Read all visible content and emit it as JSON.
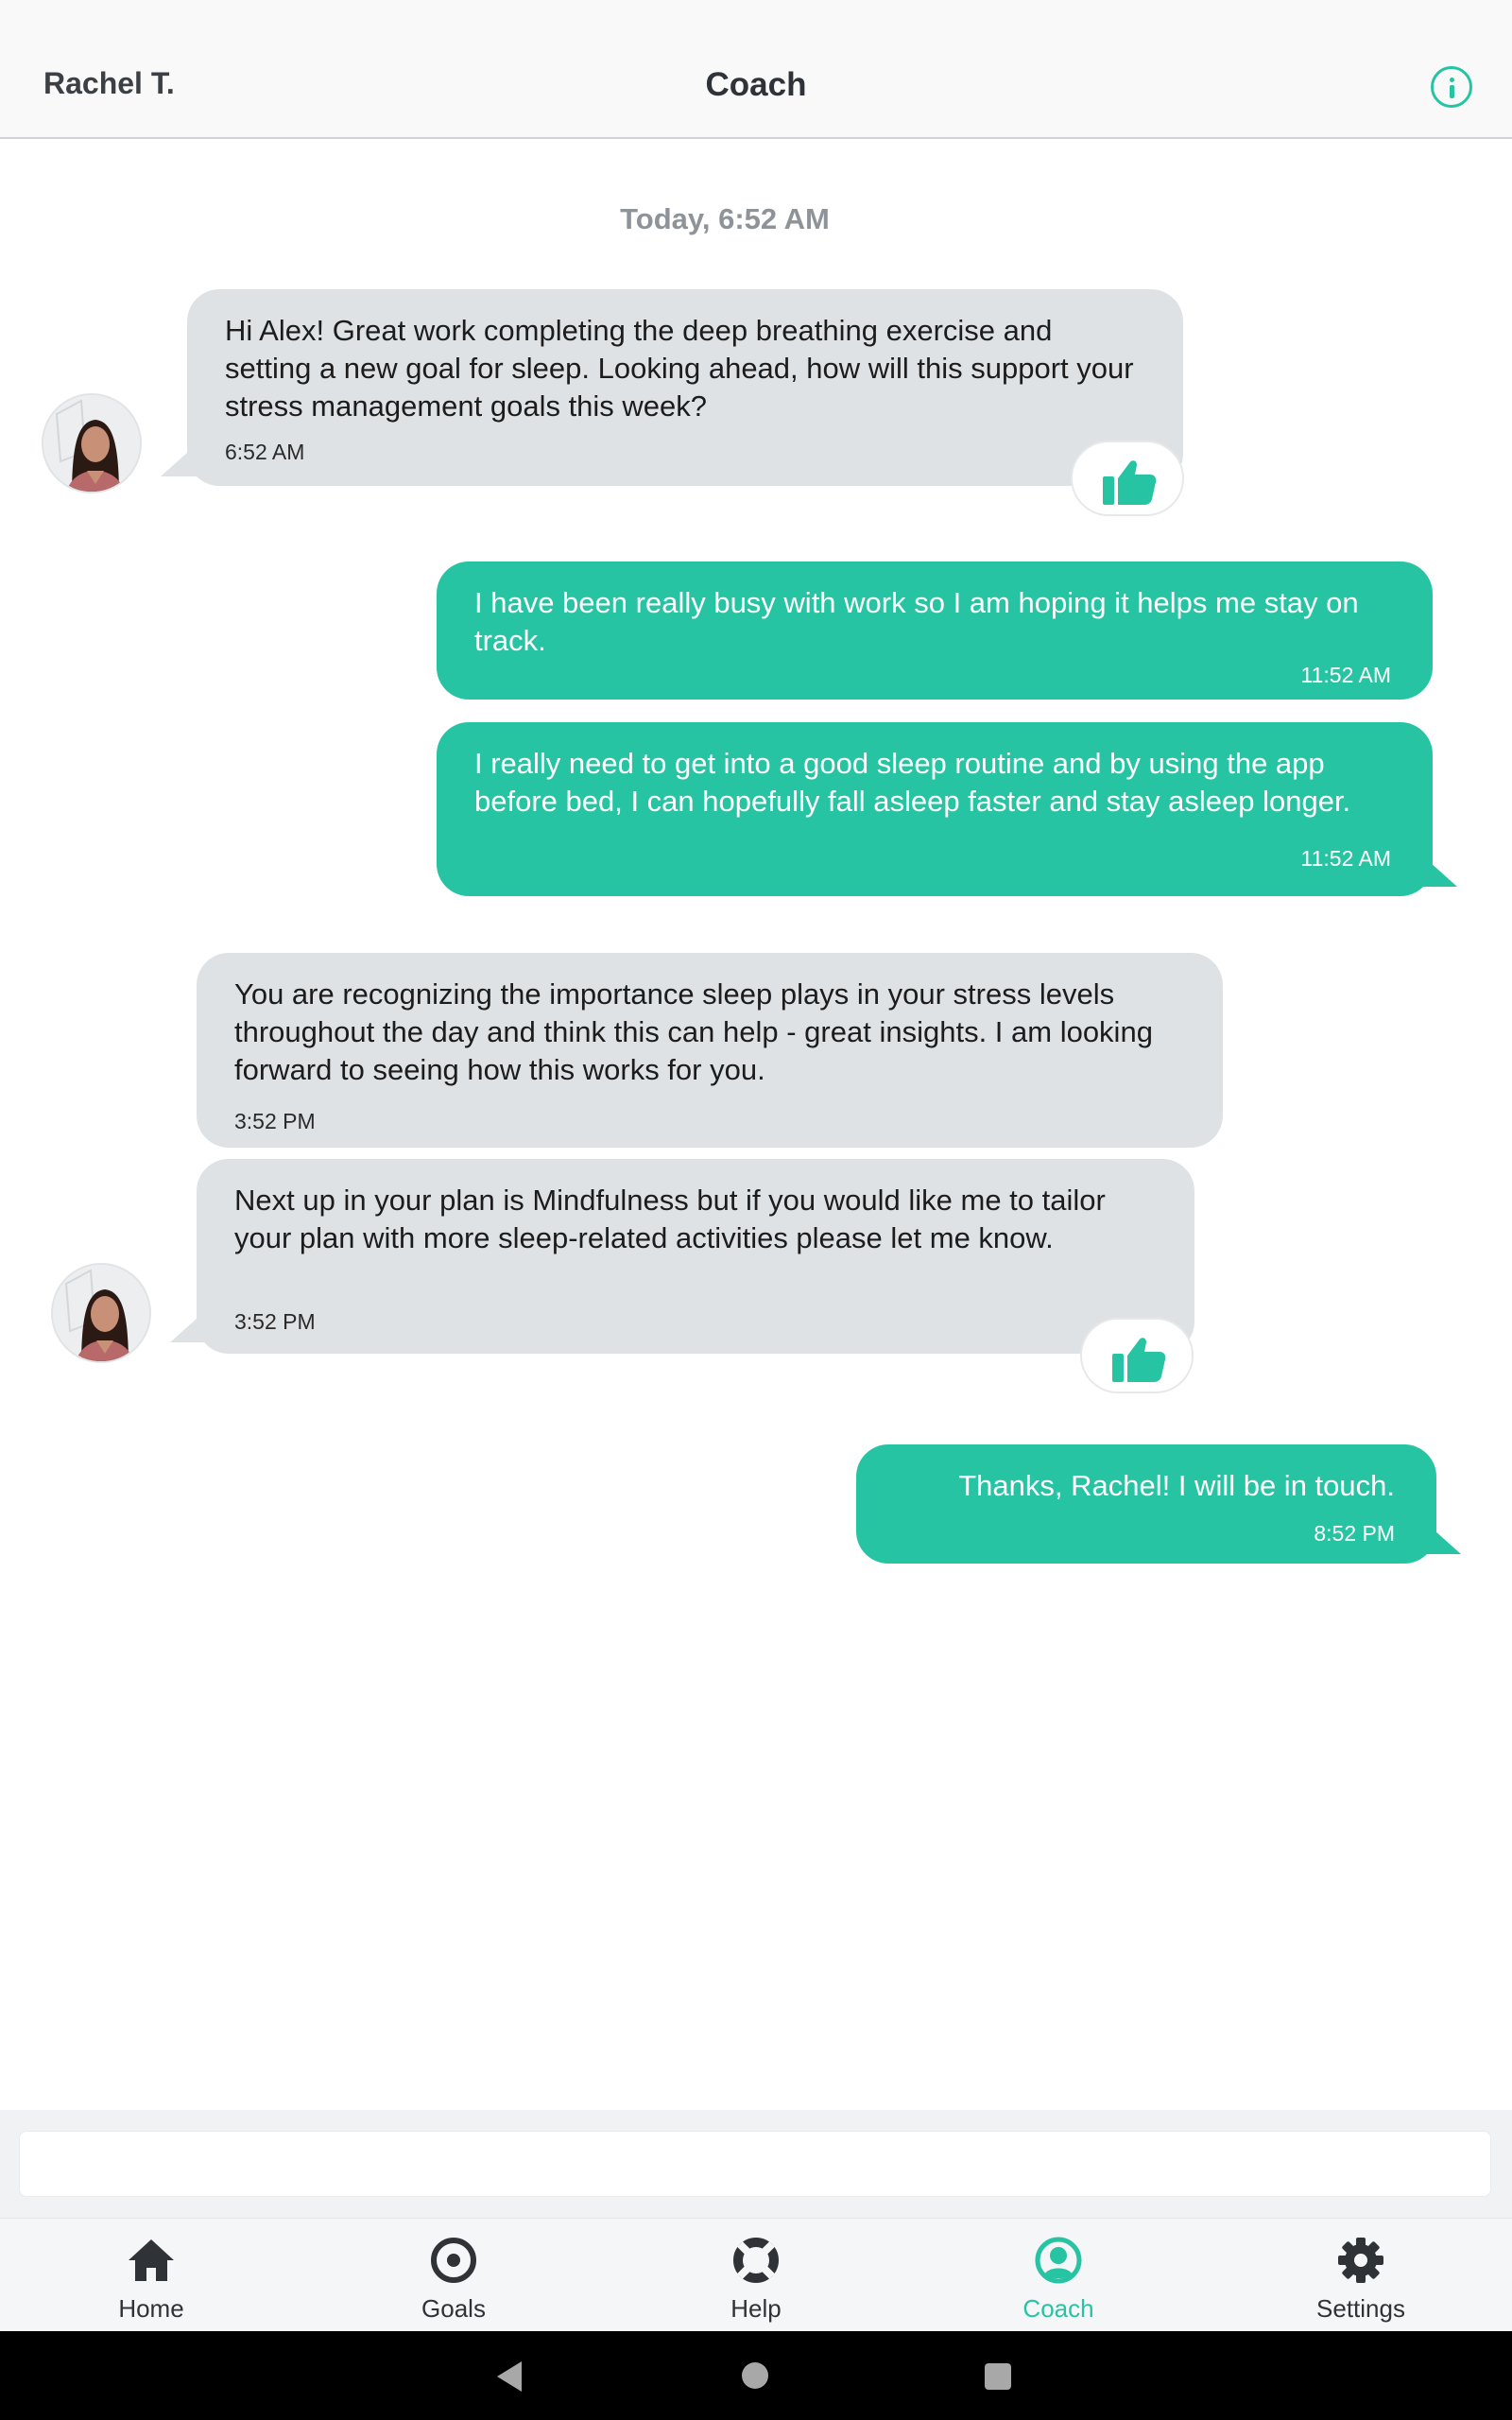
{
  "header": {
    "coach_name": "Rachel T.",
    "title": "Coach",
    "info_icon": "info-icon"
  },
  "chat": {
    "date_separator": "Today, 6:52 AM",
    "messages": [
      {
        "direction": "incoming",
        "text": "Hi Alex! Great work completing the deep breathing exercise and setting a new goal for sleep. Looking ahead, how will this support your stress management goals this week?",
        "time": "6:52 AM",
        "liked": true
      },
      {
        "direction": "outgoing",
        "text": "I have been really busy with work so I am hoping it helps me stay on track.",
        "time": "11:52 AM"
      },
      {
        "direction": "outgoing",
        "text": "I really need to get into a good sleep routine and by using the app before bed, I can hopefully fall asleep faster and stay asleep longer.",
        "time": "11:52 AM"
      },
      {
        "direction": "incoming",
        "text": "You are recognizing the importance sleep plays in your stress levels throughout the day and think this can help - great insights. I am looking forward to seeing how this works for you.",
        "time": "3:52 PM"
      },
      {
        "direction": "incoming",
        "text": "Next up in your plan is Mindfulness but if you would like me to tailor your plan with more sleep-related activities please let me know.",
        "time": "3:52 PM",
        "liked": true
      },
      {
        "direction": "outgoing",
        "text": "Thanks, Rachel! I will be in touch.",
        "time": "8:52 PM"
      }
    ]
  },
  "composer": {
    "placeholder": "",
    "value": ""
  },
  "nav": {
    "items": [
      {
        "label": "Home",
        "icon": "home-icon",
        "active": false
      },
      {
        "label": "Goals",
        "icon": "target-icon",
        "active": false
      },
      {
        "label": "Help",
        "icon": "lifebuoy-icon",
        "active": false
      },
      {
        "label": "Coach",
        "icon": "coach-icon",
        "active": true
      },
      {
        "label": "Settings",
        "icon": "gear-icon",
        "active": false
      }
    ]
  },
  "colors": {
    "accent": "#26c4a3",
    "incoming_bubble": "#dfe2e5",
    "header_bg": "#f9f9fa"
  }
}
